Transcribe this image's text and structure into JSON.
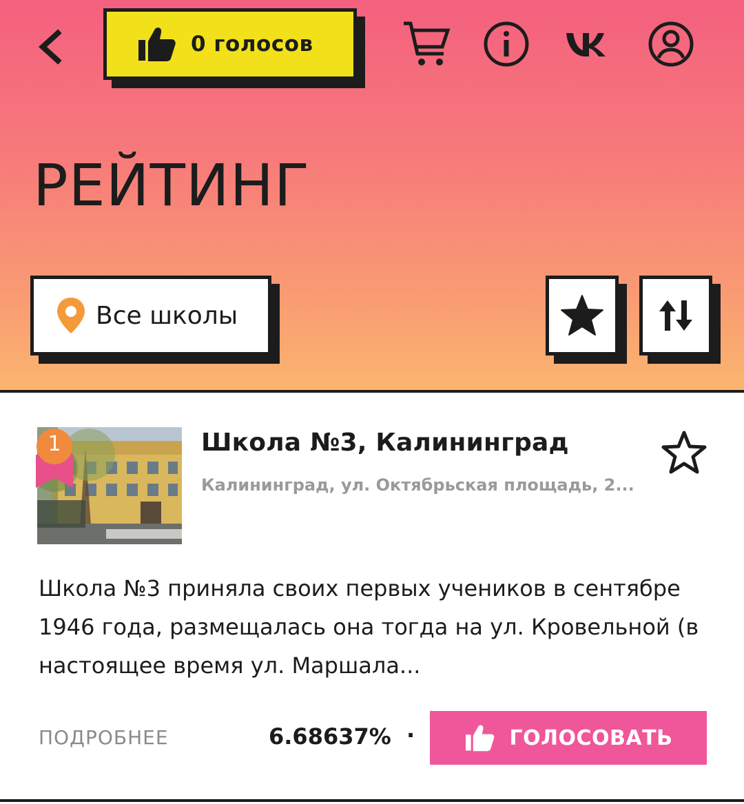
{
  "header": {
    "votes_label": "0 голосов",
    "page_title": "РЕЙТИНГ",
    "filter_label": "Все школы",
    "icons": [
      "back-chevron",
      "thumbs-up",
      "cart",
      "info",
      "vk",
      "profile",
      "star",
      "sort-arrows"
    ]
  },
  "colors": {
    "header_gradient_top": "#f4607f",
    "header_gradient_bottom": "#fbb56f",
    "votes_box": "#f2e11a",
    "vote_button": "#f0569a",
    "rank_badge": "#f08a3c",
    "rank_ribbon": "#e8508a",
    "pin": "#f59a3a"
  },
  "card": {
    "rank": "1",
    "school_name": "Школа №3, Калининград",
    "address": "Калининград, ул. Октябрьская площадь, 2...",
    "description": "Школа №3 приняла своих первых учеников в сентябре 1946 года, размещалась она тогда на ул. Кровельной (в настоящее время ул. Маршала...",
    "more_label": "ПОДРОБНЕЕ",
    "percent": "6.68637%",
    "separator": "·",
    "vote_label": "ГОЛОСОВАТЬ"
  }
}
